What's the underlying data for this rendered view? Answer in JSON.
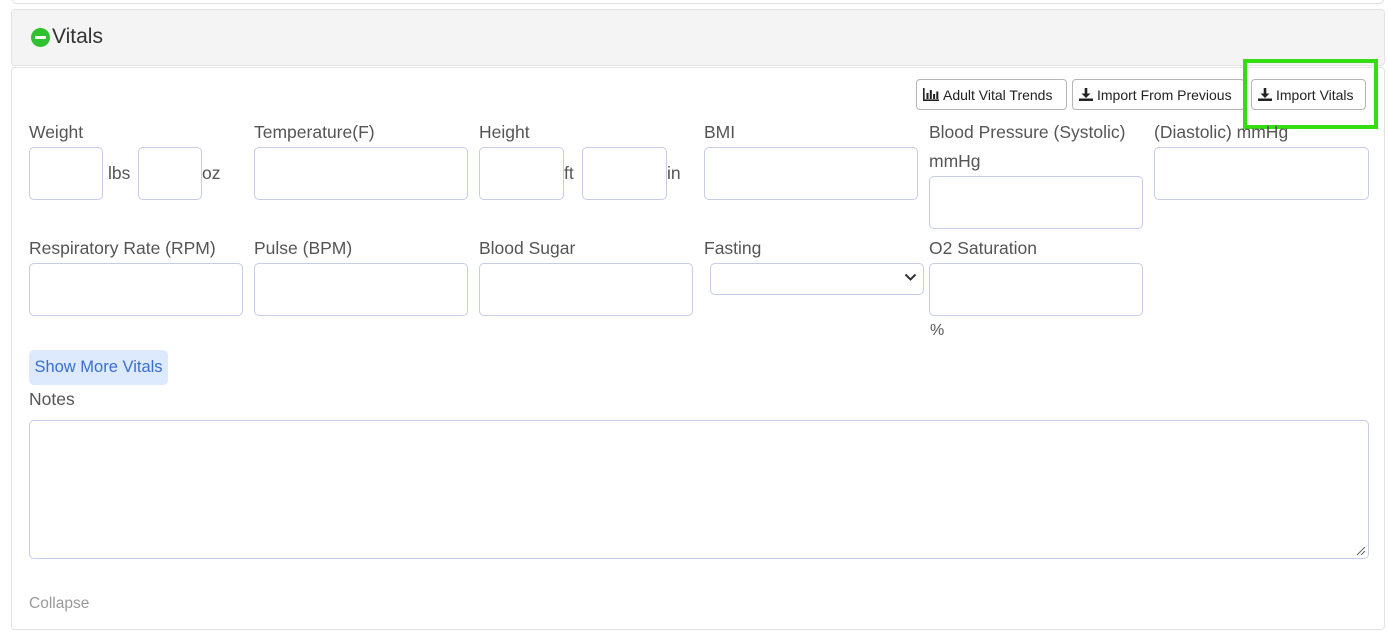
{
  "section": {
    "title": "Vitals",
    "collapse_icon": "minus-circle-icon",
    "accent_color": "#2fc12f"
  },
  "toolbar": {
    "trends_label": "Adult Vital Trends",
    "trends_icon": "bar-chart-icon",
    "import_previous_label": "Import From Previous",
    "import_vitals_label": "Import Vitals",
    "import_icon": "download-icon",
    "highlight_color": "#33dd11"
  },
  "fields": {
    "weight": {
      "label": "Weight",
      "unit1": "lbs",
      "unit2": "oz",
      "value1": "",
      "value2": ""
    },
    "temperature": {
      "label": "Temperature(F)",
      "value": ""
    },
    "height": {
      "label": "Height",
      "unit1": "ft",
      "unit2": "in",
      "value1": "",
      "value2": ""
    },
    "bmi": {
      "label": "BMI",
      "value": ""
    },
    "bp_systolic": {
      "label_line1": "Blood Pressure (Systolic)",
      "label_line2": "mmHg",
      "value": ""
    },
    "bp_diastolic": {
      "label": "(Diastolic) mmHg",
      "value": ""
    },
    "respiratory_rate": {
      "label": "Respiratory Rate (RPM)",
      "value": ""
    },
    "pulse": {
      "label": "Pulse (BPM)",
      "value": ""
    },
    "blood_sugar": {
      "label": "Blood Sugar",
      "value": ""
    },
    "fasting": {
      "label": "Fasting",
      "selected": ""
    },
    "o2_saturation": {
      "label": "O2 Saturation",
      "unit": "%",
      "value": ""
    }
  },
  "show_more_label": "Show More Vitals",
  "notes": {
    "label": "Notes",
    "value": ""
  },
  "collapse_label": "Collapse"
}
